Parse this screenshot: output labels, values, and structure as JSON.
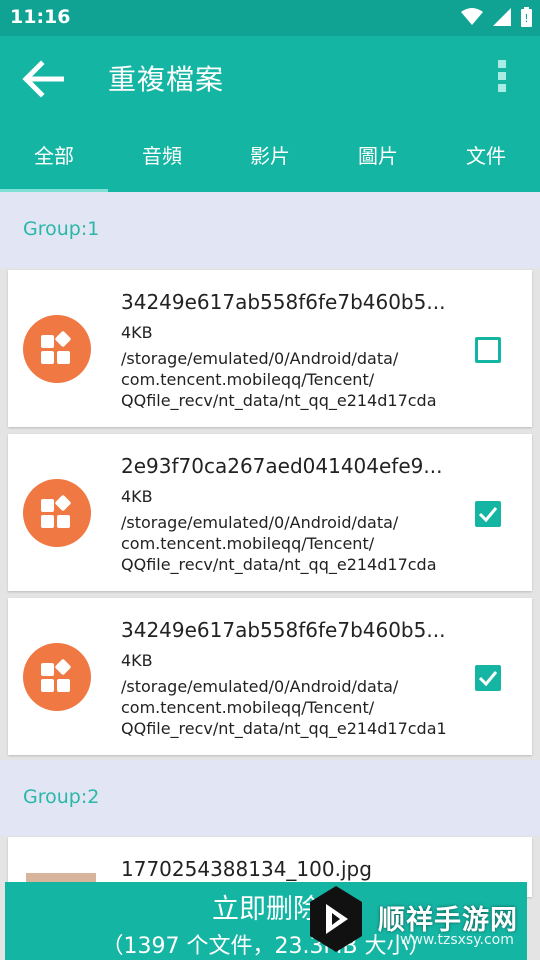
{
  "status": {
    "time": "11:16"
  },
  "appbar": {
    "title": "重複檔案"
  },
  "tabs": [
    {
      "label": "全部"
    },
    {
      "label": "音頻"
    },
    {
      "label": "影片"
    },
    {
      "label": "圖片"
    },
    {
      "label": "文件"
    }
  ],
  "groups": [
    {
      "title": "Group:1"
    },
    {
      "title": "Group:2"
    }
  ],
  "files": [
    {
      "name": "34249e617ab558f6fe7b460b5...",
      "size": "4KB",
      "path1": "/storage/emulated/0/Android/data/",
      "path2": "com.tencent.mobileqq/Tencent/",
      "path3": "QQfile_recv/nt_data/nt_qq_e214d17cda",
      "checked": false
    },
    {
      "name": "2e93f70ca267aed041404efe9...",
      "size": "4KB",
      "path1": "/storage/emulated/0/Android/data/",
      "path2": "com.tencent.mobileqq/Tencent/",
      "path3": "QQfile_recv/nt_data/nt_qq_e214d17cda",
      "checked": true
    },
    {
      "name": "34249e617ab558f6fe7b460b5...",
      "size": "4KB",
      "path1": "/storage/emulated/0/Android/data/",
      "path2": "com.tencent.mobileqq/Tencent/",
      "path3": "QQfile_recv/nt_data/nt_qq_e214d17cda1",
      "checked": true
    },
    {
      "name": "1770254388134_100.jpg"
    }
  ],
  "bottom": {
    "main_label": "立即删除",
    "sub_label": "（1397 个文件，23.3MB 大小）"
  },
  "watermark": {
    "brand": "顺祥手游网",
    "url": "www.tzsxsy.com"
  },
  "colors": {
    "primary": "#15b5a4",
    "accent_icon": "#f07843",
    "group_bg": "#e2e5f4"
  }
}
